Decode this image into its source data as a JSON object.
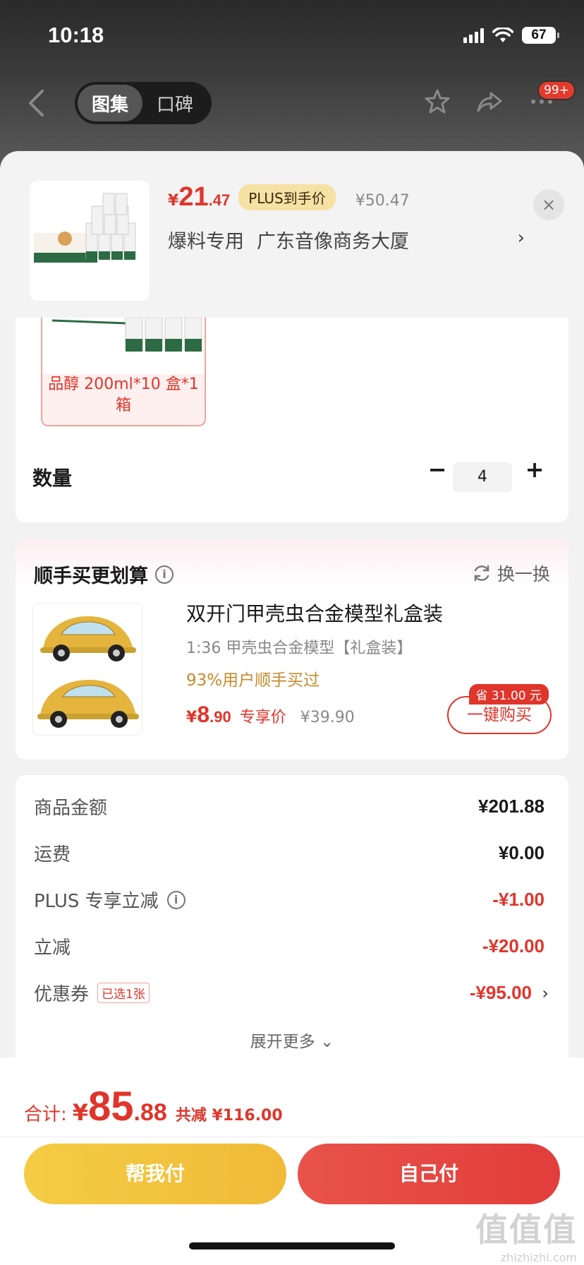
{
  "status_bar": {
    "time": "10:18",
    "battery": "67"
  },
  "nav": {
    "tabs": [
      {
        "label": "图集",
        "active": true
      },
      {
        "label": "口碑",
        "active": false
      }
    ],
    "cart_badge": "99+"
  },
  "product": {
    "price_yen": "¥",
    "price_int": "21",
    "price_dec": ".47",
    "plus_tag": "PLUS到手价",
    "original_price": "¥50.47",
    "address_tag": "爆料专用",
    "address": "广东音像商务大厦",
    "close_icon": "×"
  },
  "spec": {
    "label": "品醇 200ml*10 盒*1 箱"
  },
  "quantity": {
    "label": "数量",
    "minus": "−",
    "value": "4",
    "plus": "+"
  },
  "upsell": {
    "title": "顺手买更划算",
    "swap_label": "换一换",
    "name": "双开门甲壳虫合金模型礼盒装",
    "subtitle": "1:36 甲壳虫合金模型【礼盒装】",
    "rate": "93%用户顺手买过",
    "price_yen": "¥",
    "price_int": "8",
    "price_dec": ".90",
    "exclusive_label": "专享价",
    "original_price": "¥39.90",
    "save_badge": "省 31.00 元",
    "buy_label": "一键购买"
  },
  "summary": {
    "rows": [
      {
        "label": "商品金额",
        "value": "¥201.88",
        "red": false
      },
      {
        "label": "运费",
        "value": "¥0.00",
        "red": false
      },
      {
        "label": "PLUS 专享立减",
        "value": "-¥1.00",
        "red": true
      },
      {
        "label": "立减",
        "value": "-¥20.00",
        "red": true
      },
      {
        "label": "优惠券",
        "tag": "已选1张",
        "value": "-¥95.00",
        "red": true
      }
    ],
    "expand_label": "展开更多 ⌄"
  },
  "footer": {
    "total_label": "合计:",
    "total_yen": "¥",
    "total_int": "85",
    "total_dec": ".88",
    "total_save": "共减 ¥116.00",
    "pay_friend": "帮我付",
    "pay_self": "自己付"
  },
  "watermark": {
    "logo": "值值值",
    "site": "zhizhizhi.com"
  },
  "colors": {
    "accent": "#e0352b",
    "gold": "#f4cc44",
    "plus_tag_bg": "#f6e1a4"
  }
}
